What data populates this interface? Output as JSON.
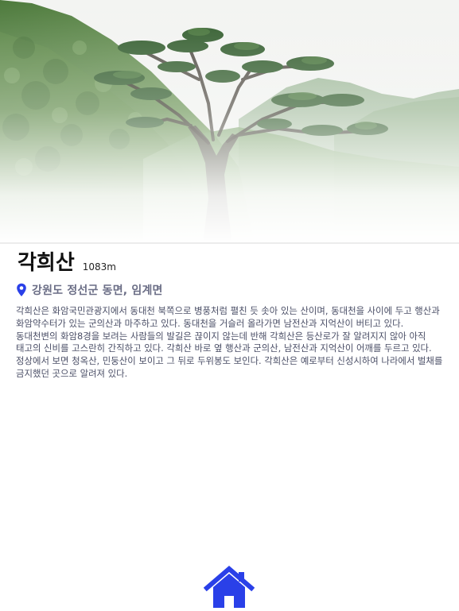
{
  "mountain": {
    "name": "각희산",
    "elevation": "1083m",
    "location": "강원도 정선군 동면, 임계면",
    "location_icon": "map-pin-icon",
    "description": "각희산은 화암국민관광지에서 동대천 북쪽으로 병풍처럼 펼친 듯 솟아 있는 산이며, 동대천을 사이에 두고 행산과 화암약수터가 있는 군의산과 마주하고 있다. 동대천을 거슬러 올라가면 남전산과 지억산이 버티고 있다. 동대천변의 화암8경을 보려는 사람들의 발길은 끊이지 않는데 반해 각희산은 등산로가 잘 알려지지 않아 아직 태고의 신비를 고스란히 간직하고 있다. 각희산 바로 옆 행산과 군의산, 남전산과 지억산이 어깨를 두르고 있다. 정상에서 보면 청옥산, 민둥산이 보이고 그 뒤로 두위봉도 보인다. 각희산은 예로부터 신성시하여 나라에서 벌채를 금지했던 곳으로 알려져 있다."
  },
  "hero": {
    "image": "mountain-pine-tree-photo"
  },
  "navigation": {
    "home_icon": "home-icon"
  },
  "colors": {
    "accent": "#2a40e8",
    "location_text": "#6b6e86",
    "body_text": "#4a4e66"
  }
}
